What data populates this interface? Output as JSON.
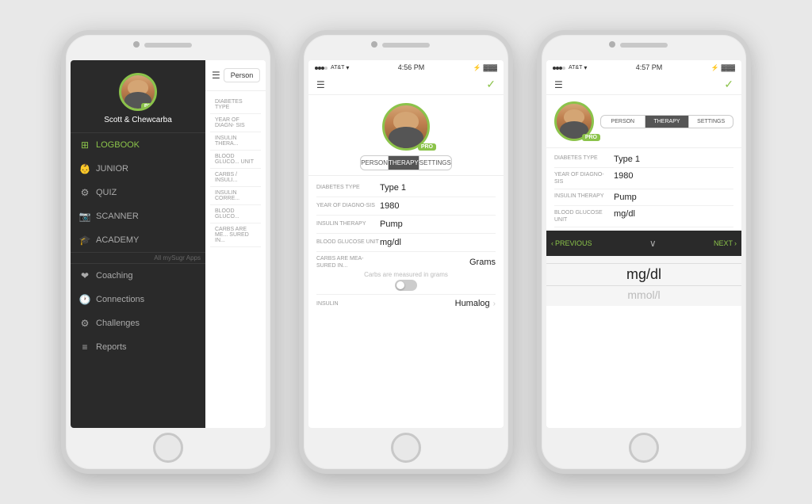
{
  "background_color": "#e0e0e0",
  "phone1": {
    "sidebar": {
      "user_name": "Scott & Chewcarba",
      "pro_label": "PRO",
      "nav_items": [
        {
          "id": "logbook",
          "label": "LOGBOOK",
          "icon": "⊞",
          "active": true
        },
        {
          "id": "junior",
          "label": "JUNIOR",
          "icon": "👶"
        },
        {
          "id": "quiz",
          "label": "QUIZ",
          "icon": "⚙"
        },
        {
          "id": "scanner",
          "label": "SCANNER",
          "icon": "📷"
        },
        {
          "id": "academy",
          "label": "ACADEMY",
          "icon": "🎓"
        }
      ],
      "all_apps_label": "All mySugr Apps",
      "secondary_items": [
        {
          "id": "coaching",
          "label": "Coaching",
          "icon": "❤"
        },
        {
          "id": "connections",
          "label": "Connections",
          "icon": "🕐"
        },
        {
          "id": "challenges",
          "label": "Challenges",
          "icon": "⚙"
        },
        {
          "id": "reports",
          "label": "Reports",
          "icon": "≡"
        }
      ]
    },
    "right_panel": {
      "tab_label": "Person",
      "fields": [
        {
          "label": "DIABETES TYPE",
          "value": ""
        },
        {
          "label": "YEAR OF DIAGNO- SIS",
          "value": ""
        },
        {
          "label": "INSULIN THERA...",
          "value": ""
        },
        {
          "label": "BLOOD GLUCO... UNIT",
          "value": ""
        },
        {
          "label": "CARBS / INSULI...",
          "value": ""
        },
        {
          "label": "INSULIN CORRE...",
          "value": ""
        },
        {
          "label": "BLOOD GLUCO...",
          "value": ""
        },
        {
          "label": "CARBS ARE ME... SURED IN...",
          "value": ""
        }
      ]
    }
  },
  "phone2": {
    "status_bar": {
      "carrier": "AT&T",
      "signal": "●●●○",
      "time": "4:56 PM",
      "bluetooth": "⚡",
      "battery": "■■■"
    },
    "tabs": [
      {
        "id": "person",
        "label": "PERSON",
        "active": false
      },
      {
        "id": "therapy",
        "label": "THERAPY",
        "active": true
      },
      {
        "id": "settings",
        "label": "SETTINGS",
        "active": false
      }
    ],
    "pro_label": "PRO",
    "fields": [
      {
        "label": "DIABETES TYPE",
        "value": "Type 1"
      },
      {
        "label": "YEAR OF DIAGNO- SIS",
        "value": "1980"
      },
      {
        "label": "INSULIN THERAPY",
        "value": "Pump"
      },
      {
        "label": "BLOOD GLUCOSE UNIT",
        "value": "mg/dl"
      },
      {
        "label": "CARBS / ARE MEA- SURED IN...",
        "value": "Grams"
      }
    ],
    "toggle_hint": "Carbs are measured in grams",
    "insulin_label": "INSULIN",
    "insulin_value": "Humalog"
  },
  "phone3": {
    "status_bar": {
      "carrier": "AT&T",
      "signal": "●●●○",
      "time": "4:57 PM",
      "bluetooth": "⚡",
      "battery": "■■■"
    },
    "tabs": [
      {
        "id": "person",
        "label": "PERSON",
        "active": false
      },
      {
        "id": "therapy",
        "label": "THERAPY",
        "active": true
      },
      {
        "id": "settings",
        "label": "SETTINGS",
        "active": false
      }
    ],
    "pro_label": "PRO",
    "fields": [
      {
        "label": "DIABETES TYPE",
        "value": "Type 1"
      },
      {
        "label": "YEAR OF DIAGNO- SIS",
        "value": "1980"
      },
      {
        "label": "INSULIN THERAPY",
        "value": "Pump"
      },
      {
        "label": "BLOOD GLUCOSE UNIT",
        "value": "mg/dl"
      }
    ],
    "nav_bar": {
      "prev_label": "PREVIOUS",
      "next_label": "NEXT",
      "chevron_left": "‹",
      "chevron_right": "›",
      "chevron_down": "∨"
    },
    "picker": {
      "selected": "mg/dl",
      "dim": "mmol/l"
    }
  }
}
